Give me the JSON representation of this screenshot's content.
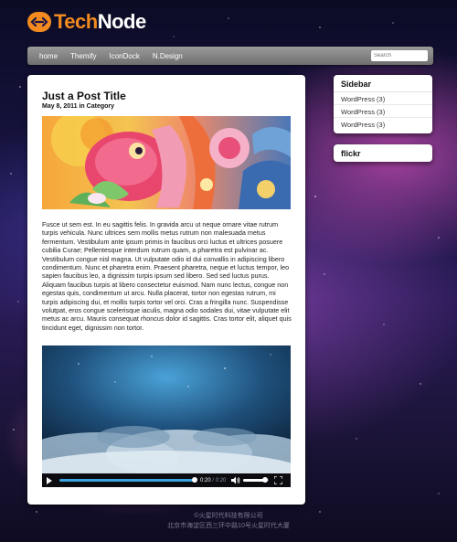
{
  "brand": {
    "name_part1": "Tech",
    "name_part2": "Node",
    "color_orange": "#f28a1f"
  },
  "nav": {
    "items": [
      "home",
      "Themify",
      "IconDock",
      "N.Design"
    ],
    "search_placeholder": "Search"
  },
  "post": {
    "title": "Just a Post Title",
    "date": "May 8, 2011",
    "meta_in": "in",
    "category": "Category",
    "body": "Fusce ut sem est. In eu sagittis felis. In gravida arcu ut neque ornare vitae rutrum turpis vehicula. Nunc ultrices sem mollis metus rutrum non malesuada metus fermentum. Vestibulum ante ipsum primis in faucibus orci luctus et ultrices posuere cubilia Curae; Pellentesque interdum rutrum quam, a pharetra est pulvinar ac. Vestibulum congue nisl magna. Ut vulputate odio id dui convallis in adipiscing libero condimentum. Nunc et pharetra enim. Praesent pharetra, neque et luctus tempor, leo sapien faucibus leo, a dignissim turpis ipsum sed libero. Sed sed luctus purus. Aliquam faucibus turpis at libero consectetur euismod. Nam nunc lectus, congue non egestas quis, condimentum ut arcu. Nulla placerat, tortor non egestas rutrum, mi turpis adipiscing dui, et mollis turpis tortor vel orci. Cras a fringilla nunc. Suspendisse volutpat, eros congue scelerisque iaculis, magna odio sodales dui, vitae vulputate elit metus ac arcu. Mauris consequat rhoncus dolor id sagittis. Cras tortor elit, aliquet quis tincidunt eget, dignissim non tortor."
  },
  "video": {
    "current_time": "0:20",
    "separator": "/",
    "duration": "0:20",
    "progress": 1.0,
    "volume": 0.85
  },
  "sidebar": {
    "title": "Sidebar",
    "items": [
      "WordPress (3)",
      "WordPress (3)",
      "WordPress (3)"
    ]
  },
  "flickr": {
    "title": "flickr"
  },
  "footer": {
    "line1": "©火星时代科技有限公司",
    "line2": "北京市海淀区西三环中路10号火星时代大厦"
  }
}
